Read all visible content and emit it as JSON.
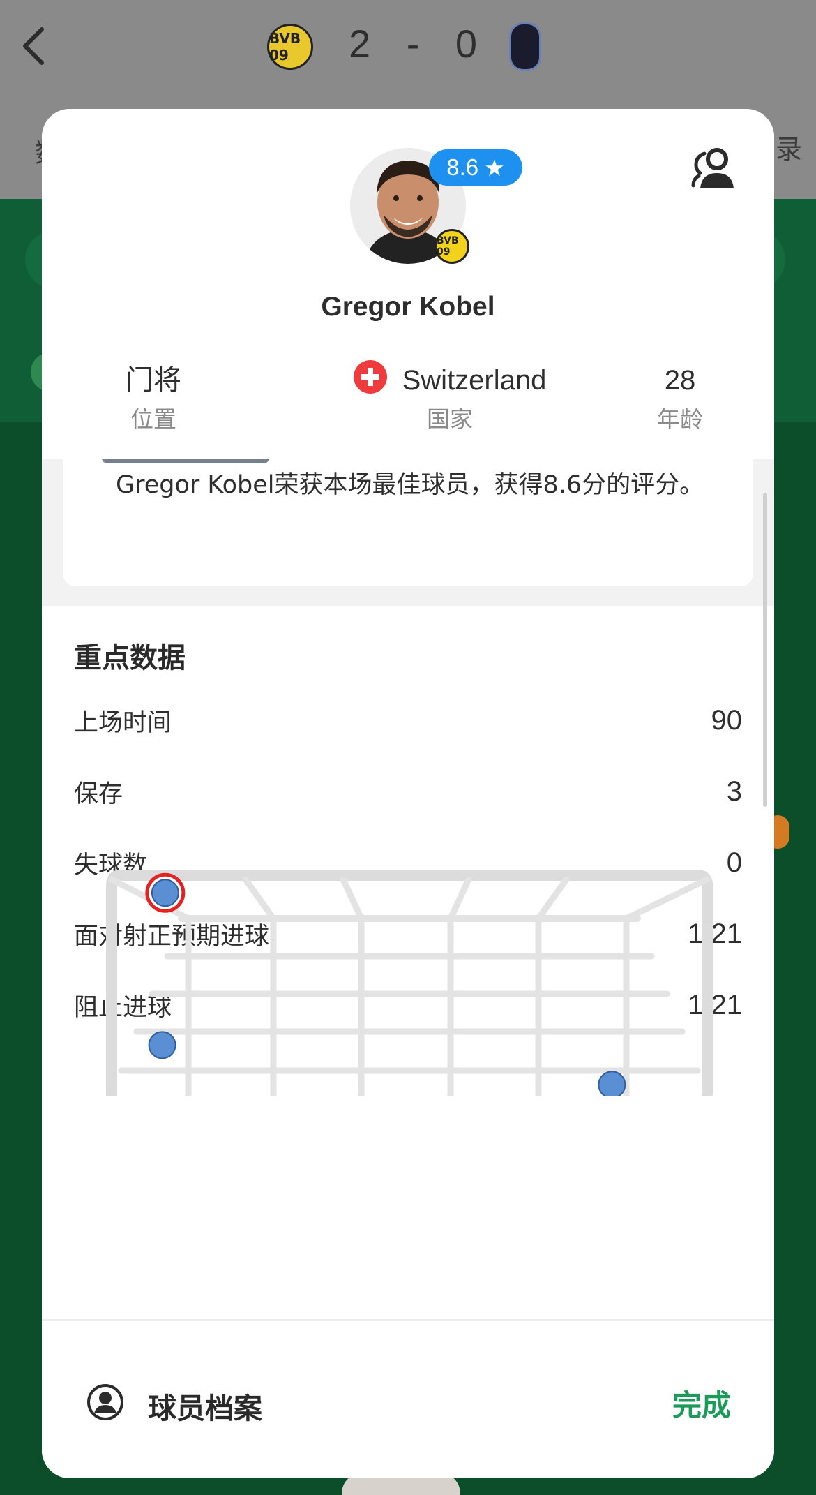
{
  "header": {
    "score": "2 - 0",
    "home_badge": "BVB 09",
    "tab_left_fragment": "数",
    "tab_right_fragment": "录"
  },
  "player": {
    "rating": "8.6",
    "club_badge": "BVB 09",
    "name": "Gregor Kobel",
    "position_value": "门将",
    "position_label": "位置",
    "country_value": "Switzerland",
    "country_label": "国家",
    "age_value": "28",
    "age_label": "年龄"
  },
  "summary": {
    "text": "Gregor Kobel荣获本场最佳球员，获得8.6分的评分。"
  },
  "key_stats": {
    "title": "重点数据",
    "rows": [
      {
        "label": "上场时间",
        "value": "90"
      },
      {
        "label": "保存",
        "value": "3"
      },
      {
        "label": "失球数",
        "value": "0"
      },
      {
        "label": "面对射正预期进球",
        "value": "1.21"
      },
      {
        "label": "阻止进球",
        "value": "1.21"
      }
    ]
  },
  "shot_map": {
    "shots": [
      {
        "goal_x": 0.09,
        "goal_y": 0.08,
        "highlighted": true
      },
      {
        "goal_x": 0.085,
        "goal_y": 0.77,
        "highlighted": false
      },
      {
        "goal_x": 0.84,
        "goal_y": 0.95,
        "highlighted": false
      }
    ]
  },
  "footer": {
    "profile_label": "球员档案",
    "done_label": "完成"
  },
  "colors": {
    "accent_blue": "#1e90f0",
    "done_green": "#1c9a59",
    "shot_blue": "#5b8fd3",
    "highlight_red": "#e52222"
  }
}
